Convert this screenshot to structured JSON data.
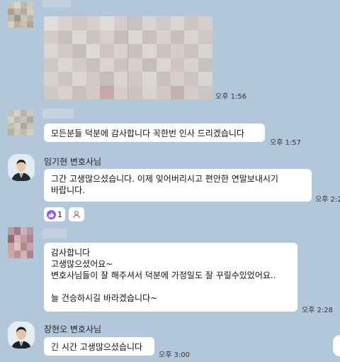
{
  "messages": [
    {
      "id": "m1",
      "type": "photo",
      "time": "오후 1:56"
    },
    {
      "id": "m2",
      "type": "text",
      "text": "모든분들 덕분에 감사합니다 꼭한번 인사 드리겠습니다",
      "time": "오후 1:57"
    },
    {
      "id": "m3",
      "type": "text",
      "sender": "임기현 변호사님",
      "text": "그간 고생많으셨습니다. 이제 잊어버리시고 편안한 연말보내시기\n바랍니다.",
      "time": "오후 2:2",
      "reaction_count": "1"
    },
    {
      "id": "m4",
      "type": "text",
      "text": "감사합니다\n고생많으셨어요~\n변호사님들이 잘 해주셔서 덕분에 가정일도 잘 꾸릴수있었어요..\n\n늘 건승하시길 바라겠습니다~",
      "time": "오후 2:28"
    },
    {
      "id": "m5",
      "type": "text",
      "sender": "장현오 변호사님",
      "text": "긴 시간 고생많으셨습니다",
      "time": "오후 3:00"
    }
  ],
  "icons": {
    "reaction": "thumbs-up-icon",
    "profile": "person-icon"
  },
  "colors": {
    "background": "#b2c7da",
    "bubble": "#ffffff",
    "reaction": "#8a5cf0"
  }
}
